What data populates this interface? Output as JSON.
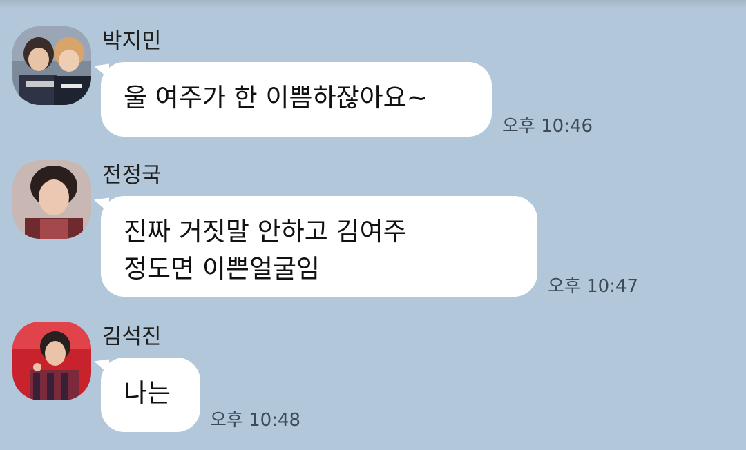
{
  "messages": [
    {
      "sender": "박지민",
      "text": "울 여주가 한 이쁨하잖아요~",
      "time": "오후 10:46"
    },
    {
      "sender": "전정국",
      "text": "진짜 거짓말 안하고 김여주\n정도면 이쁜얼굴임",
      "time": "오후 10:47"
    },
    {
      "sender": "김석진",
      "text": "나는",
      "time": "오후 10:48"
    }
  ]
}
